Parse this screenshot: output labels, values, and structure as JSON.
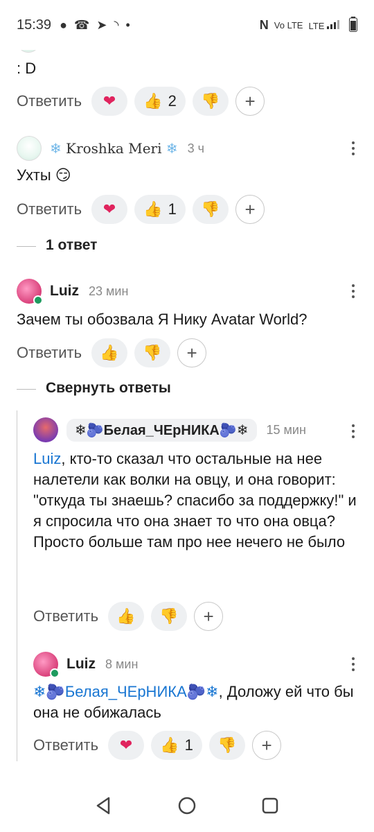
{
  "status_bar": {
    "time": "15:39",
    "left_icons": [
      "chat-bubble-icon",
      "missed-call-icon",
      "telegram-icon",
      "rss-icon",
      "dot-icon"
    ],
    "right_icons": [
      "nfc-icon",
      "volte-icon",
      "lte-signal-icon",
      "battery-icon"
    ],
    "volte_text": "Vo LTE",
    "lte_text": "LTE"
  },
  "actions": {
    "reply_label": "Ответить"
  },
  "comments": [
    {
      "text": ": D",
      "reactions": {
        "like_count": "2"
      }
    },
    {
      "author": "Kroshka Meri",
      "time": "3 ч",
      "text": "Ухты 😏",
      "reactions": {
        "like_count": "1"
      }
    },
    {
      "author": "Luiz",
      "time": "23 мин",
      "text": "Зачем ты обозвала Я Нику Avatar World?"
    },
    {
      "author": "❄🫐Белая_ЧЕрНИКА🫐❄",
      "time": "15 мин",
      "mention": "Luiz",
      "text": ", кто-то сказал что остальные на нее налетели как волки на овцу, и она говорит: \"откуда ты знаешь? спасибо за поддержку!\" и я спросила что она знает то что она овца? Просто больше там про нее нечего не было"
    },
    {
      "author": "Luiz",
      "time": "8 мин",
      "mention": "❄🫐Белая_ЧЕрНИКА🫐❄",
      "text": ", Доложу ей что бы она не обижалась",
      "reactions": {
        "like_count": "1"
      }
    }
  ],
  "threads": {
    "one_reply": "1 ответ",
    "collapse": "Свернуть ответы"
  },
  "colors": {
    "accent": "#1976d2",
    "online": "#1e9b5f",
    "pill_bg": "#eef0f2"
  }
}
